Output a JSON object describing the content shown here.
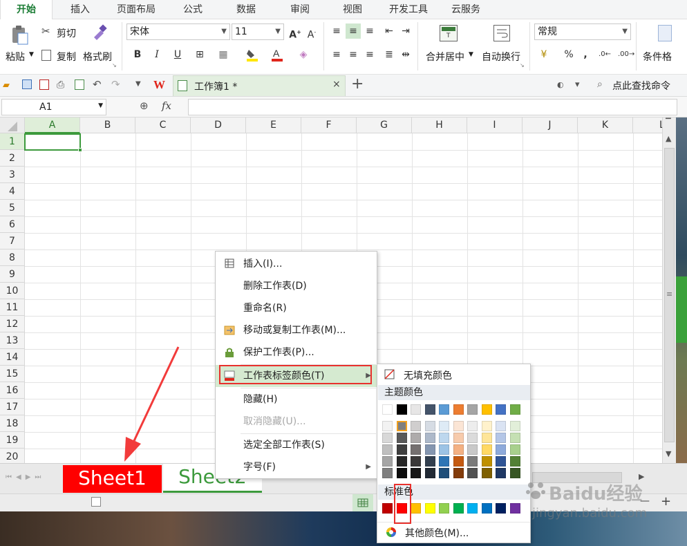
{
  "menubar": {
    "tabs": [
      {
        "label": "开始",
        "active": true
      },
      {
        "label": "插入"
      },
      {
        "label": "页面布局"
      },
      {
        "label": "公式"
      },
      {
        "label": "数据"
      },
      {
        "label": "审阅"
      },
      {
        "label": "视图"
      },
      {
        "label": "开发工具"
      },
      {
        "label": "云服务"
      }
    ]
  },
  "ribbon": {
    "paste": "粘贴",
    "cut": "剪切",
    "copy": "复制",
    "format_painter": "格式刷",
    "font_name": "宋体",
    "font_size": "11",
    "bold": "B",
    "italic": "I",
    "underline": "U",
    "merge_center": "合并居中",
    "wrap_text": "自动换行",
    "number_format": "常规",
    "percent": "%",
    "comma": ",",
    "conditional_format": "条件格"
  },
  "quickbar": {
    "doc_tab": "工作簿1 *",
    "search_command": "点此查找命令",
    "wps_logo": "W"
  },
  "formula_bar": {
    "cell_ref": "A1",
    "fx": "fx",
    "value": ""
  },
  "grid": {
    "columns": [
      "A",
      "B",
      "C",
      "D",
      "E",
      "F",
      "G",
      "H",
      "I",
      "J",
      "K",
      "L"
    ],
    "rows": [
      "1",
      "2",
      "3",
      "4",
      "5",
      "6",
      "7",
      "8",
      "9",
      "10",
      "11",
      "12",
      "13",
      "14",
      "15",
      "16",
      "17",
      "18",
      "19",
      "20"
    ],
    "active_cell": "A1"
  },
  "sheets": {
    "tabs": [
      {
        "label": "Sheet1",
        "color": "#ff0000",
        "active": false
      },
      {
        "label": "Sheet2",
        "color": "#ffffff",
        "active": true
      }
    ]
  },
  "status": {
    "zoom_minus": "—",
    "zoom_plus": "+"
  },
  "context_menu": {
    "items": [
      {
        "label": "插入(I)...",
        "icon": "insert-table-icon"
      },
      {
        "label": "删除工作表(D)"
      },
      {
        "label": "重命名(R)"
      },
      {
        "label": "移动或复制工作表(M)...",
        "icon": "move-copy-sheet-icon"
      },
      {
        "label": "保护工作表(P)...",
        "icon": "lock-icon"
      },
      {
        "label": "工作表标签颜色(T)",
        "icon": "tab-color-icon",
        "highlighted": true,
        "submenu": true
      },
      {
        "label": "隐藏(H)"
      },
      {
        "label": "取消隐藏(U)...",
        "disabled": true
      },
      {
        "label": "选定全部工作表(S)"
      },
      {
        "label": "字号(F)",
        "submenu": true
      }
    ]
  },
  "color_menu": {
    "no_fill": "无填充颜色",
    "theme_header": "主题颜色",
    "standard_header": "标准色",
    "more_colors": "其他颜色(M)...",
    "theme_top": [
      "#ffffff",
      "#000000",
      "#e7e6e6",
      "#44546a",
      "#5b9bd5",
      "#ed7d31",
      "#a5a5a5",
      "#ffc000",
      "#4472c4",
      "#70ad47"
    ],
    "theme_shades": [
      [
        "#f2f2f2",
        "#7f7f7f",
        "#d0cece",
        "#d6dce4",
        "#deebf6",
        "#fbe5d5",
        "#ededed",
        "#fff2cc",
        "#dae3f3",
        "#e2efd9"
      ],
      [
        "#d8d8d8",
        "#595959",
        "#aeabab",
        "#adb9ca",
        "#bdd7ee",
        "#f7cbac",
        "#dbdbdb",
        "#fee599",
        "#b4c6e7",
        "#c5e0b3"
      ],
      [
        "#bfbfbf",
        "#3f3f3f",
        "#757070",
        "#8496b0",
        "#9cc3e5",
        "#f4b183",
        "#c9c9c9",
        "#ffd965",
        "#8eaadb",
        "#a8d08d"
      ],
      [
        "#a5a5a5",
        "#262626",
        "#3a3838",
        "#323f4f",
        "#2e75b5",
        "#c55a11",
        "#7b7b7b",
        "#bf9000",
        "#2f5496",
        "#538135"
      ],
      [
        "#7f7f7f",
        "#0c0c0c",
        "#171616",
        "#222a35",
        "#1e4e79",
        "#833c0b",
        "#525252",
        "#7f6000",
        "#1f3864",
        "#375623"
      ]
    ],
    "standard": [
      "#c00000",
      "#ff0000",
      "#ffc000",
      "#ffff00",
      "#92d050",
      "#00b050",
      "#00b0f0",
      "#0070c0",
      "#002060",
      "#7030a0"
    ]
  },
  "watermark": {
    "brand": "Baidu经验",
    "url": "jingyan.baidu.com"
  }
}
